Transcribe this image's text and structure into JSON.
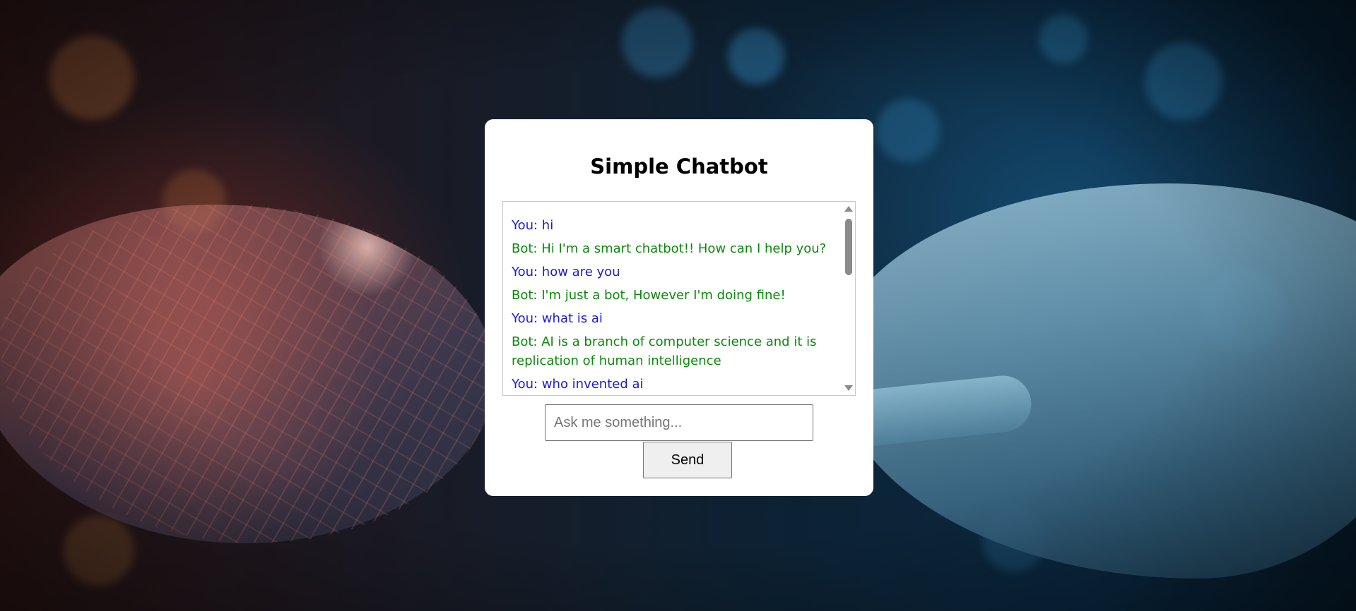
{
  "app": {
    "title": "Simple Chatbot"
  },
  "chat": {
    "messages": [
      {
        "sender": "You",
        "text": "You: hi",
        "role": "user"
      },
      {
        "sender": "Bot",
        "text": "Bot: Hi I'm a smart chatbot!! How can I help you?",
        "role": "bot"
      },
      {
        "sender": "You",
        "text": "You: how are you",
        "role": "user"
      },
      {
        "sender": "Bot",
        "text": "Bot: I'm just a bot, However I'm doing fine!",
        "role": "bot"
      },
      {
        "sender": "You",
        "text": "You: what is ai",
        "role": "user"
      },
      {
        "sender": "Bot",
        "text": "Bot: AI is a branch of computer science and it is replication of human intelligence",
        "role": "bot"
      },
      {
        "sender": "You",
        "text": "You: who invented ai",
        "role": "user"
      }
    ]
  },
  "input": {
    "placeholder": "Ask me something...",
    "value": ""
  },
  "send_button": {
    "label": "Send"
  },
  "colors": {
    "user_text": "#1a1ae0",
    "bot_text": "#0a8a0a",
    "card_bg": "#ffffff"
  },
  "icons": {
    "scroll_up": "triangle-up-icon",
    "scroll_down": "triangle-down-icon"
  }
}
